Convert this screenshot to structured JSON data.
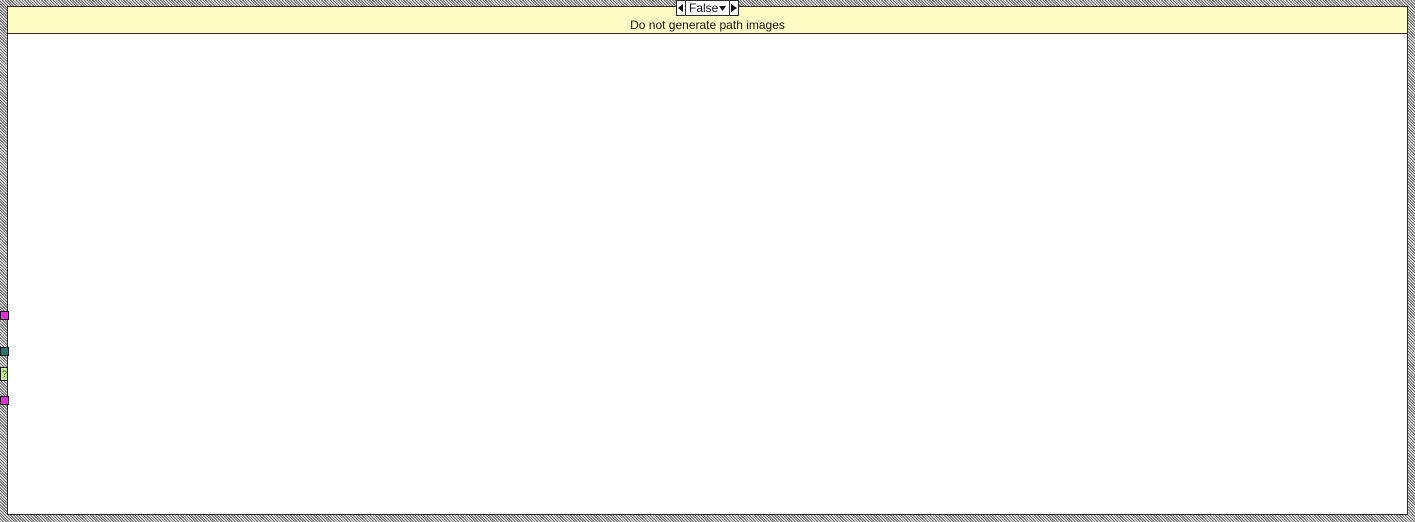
{
  "case_structure": {
    "selector_value": "False",
    "comment": "Do not generate path images",
    "colors": {
      "comment_bg": "#fffdc4",
      "tunnel_path": "#e72ce0",
      "tunnel_refnum": "#2a7373",
      "tunnel_variant": "#c5f28e"
    },
    "tunnels": [
      {
        "type": "path",
        "color": "#e72ce0"
      },
      {
        "type": "refnum",
        "color": "#2a7373"
      },
      {
        "type": "variant",
        "color": "#c5f28e",
        "glyph": "?"
      },
      {
        "type": "path",
        "color": "#e72ce0"
      }
    ]
  },
  "icons": {
    "decrement": "left-triangle-icon",
    "increment": "right-triangle-icon",
    "dropdown": "chevron-down-icon"
  }
}
